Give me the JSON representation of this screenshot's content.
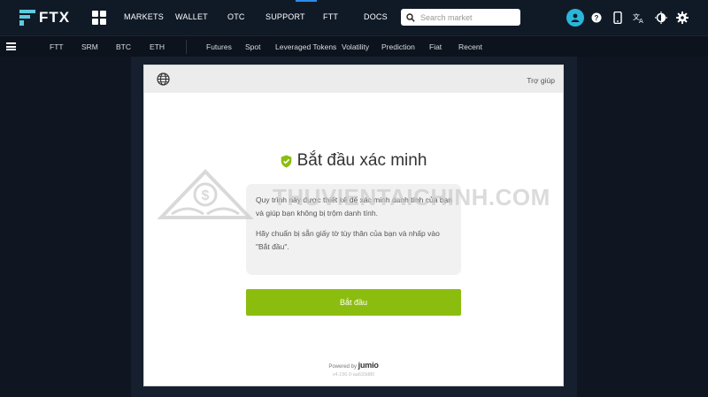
{
  "brand": {
    "name": "FTX",
    "accent": "#5fcade"
  },
  "topnav": {
    "items": [
      "MARKETS",
      "WALLET",
      "OTC",
      "SUPPORT",
      "FTT",
      "DOCS"
    ]
  },
  "search": {
    "placeholder": "Search market"
  },
  "subnav": {
    "left": [
      "FTT",
      "SRM",
      "BTC",
      "ETH"
    ],
    "right": [
      "Futures",
      "Spot",
      "Leveraged Tokens",
      "Volatility",
      "Prediction",
      "Fiat",
      "Recent"
    ]
  },
  "verify": {
    "help_label": "Trợ giúp",
    "title": "Bắt đầu xác minh",
    "para1": "Quy trình này được thiết kế để xác minh danh tính của bạn và giúp bạn không bị trộm danh tính.",
    "para2": "Hãy chuẩn bị sẵn giấy tờ tùy thân của bạn và nhấp vào \"Bắt đầu\".",
    "cta_label": "Bắt đầu",
    "powered_by": "Powered by",
    "powered_brand": "jumio",
    "version": "v4.156.0-aa633d80",
    "cta_color": "#8bbd0f"
  },
  "watermark": {
    "text": "THUVIENTAICHINH.COM"
  },
  "icons": [
    "apps-grid-icon",
    "search-icon",
    "user-avatar-icon",
    "help-icon",
    "mobile-icon",
    "translate-icon",
    "theme-icon",
    "settings-gear-icon",
    "menu-icon",
    "globe-icon",
    "shield-check-icon"
  ]
}
